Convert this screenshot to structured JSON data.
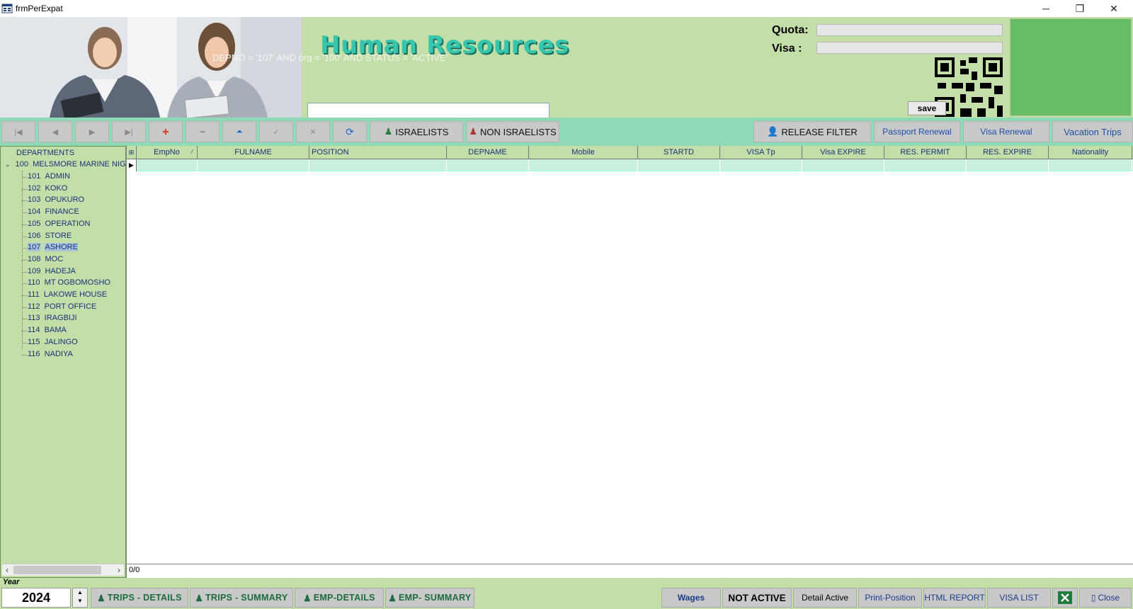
{
  "window": {
    "title": "frmPerExpat",
    "minimize_glyph": "─",
    "restore_glyph": "❐",
    "close_glyph": "✕"
  },
  "header": {
    "title": "Human Resources",
    "filter_expression": "DEPNO = '107' AND org = '100' AND STATUS = 'ACTIVE'",
    "search_value": "",
    "quota_label": "Quota:",
    "quota_value": "",
    "visa_label": "Visa :",
    "visa_value": "",
    "save_label": "save"
  },
  "toolbar": {
    "nav": {
      "first": "|◀",
      "prev": "◀",
      "next": "▶",
      "last": "▶|",
      "add": "✚",
      "delete": "━",
      "edit": "⏶",
      "post": "✓",
      "cancel": "✕",
      "refresh": "⟳"
    },
    "israelists_label": "ISRAELISTS",
    "non_israelists_label": "NON ISRAELISTS",
    "release_filter_label": "RELEASE FILTER",
    "passport_renewal_label": "Passport Renewal",
    "visa_renewal_label": "Visa Renewal",
    "vacation_trips_label": "Vacation Trips"
  },
  "tree": {
    "root": "DEPARTMENTS",
    "org": {
      "code": "100",
      "name": "MELSMORE MARINE NIGI"
    },
    "departments": [
      {
        "code": "101",
        "name": "ADMIN"
      },
      {
        "code": "102",
        "name": "KOKO"
      },
      {
        "code": "103",
        "name": "OPUKURO"
      },
      {
        "code": "104",
        "name": "FINANCE"
      },
      {
        "code": "105",
        "name": "OPERATION"
      },
      {
        "code": "106",
        "name": "STORE"
      },
      {
        "code": "107",
        "name": "ASHORE"
      },
      {
        "code": "108",
        "name": "MOC"
      },
      {
        "code": "109",
        "name": "HADEJA"
      },
      {
        "code": "110",
        "name": "MT OGBOMOSHO"
      },
      {
        "code": "111",
        "name": "LAKOWE HOUSE"
      },
      {
        "code": "112",
        "name": "PORT OFFICE"
      },
      {
        "code": "113",
        "name": "IRAGBIJI"
      },
      {
        "code": "114",
        "name": "BAMA"
      },
      {
        "code": "115",
        "name": "JALINGO"
      },
      {
        "code": "116",
        "name": "NADIYA"
      }
    ],
    "selected": "107"
  },
  "grid": {
    "columns": [
      "EmpNo",
      "FULNAME",
      "POSITION",
      "DEPNAME",
      "Mobile",
      "STARTD",
      "VISA Tp",
      "Visa EXPIRE",
      "RES. PERMIT",
      "RES. EXPIRE",
      "Nationality"
    ],
    "sort_indicator": "⁄",
    "record_status": "0/0"
  },
  "bottom": {
    "year_label": "Year",
    "year_value": "2024",
    "trips_details_label": "TRIPS - DETAILS",
    "trips_summary_label": "TRIPS - SUMMARY",
    "emp_details_label": "EMP-DETAILS",
    "emp_summary_label": "EMP- SUMMARY",
    "wages_label": "Wages",
    "not_active_label": "NOT ACTIVE",
    "detail_active_label": "Detail Active",
    "print_position_label": "Print-Position",
    "html_report_label": "HTML REPORT",
    "visa_list_label": "VISA LIST",
    "close_label": "Close"
  },
  "colors": {
    "header_bg": "#c3dea6",
    "toolbar_bg": "#8fd9b7",
    "title_text": "#35c6ad",
    "tree_text": "#1b2f80"
  }
}
